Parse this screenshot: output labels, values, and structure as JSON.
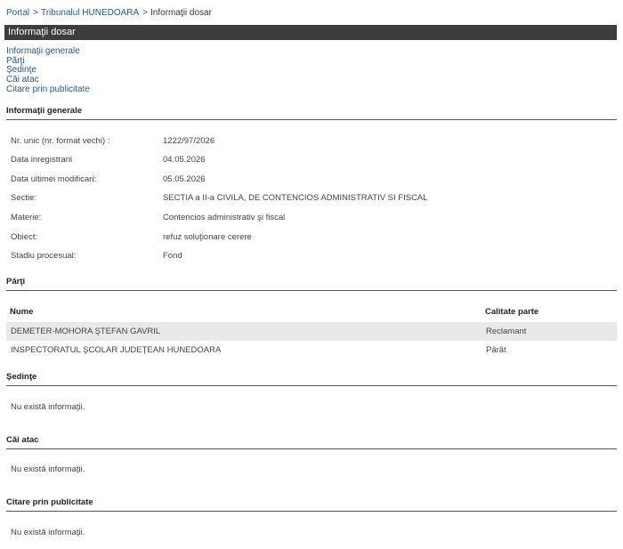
{
  "breadcrumb": {
    "portal": "Portal",
    "court": "Tribunalul HUNEDOARA",
    "current": "Informaţii dosar",
    "separator": ">"
  },
  "title": "Informaţii dosar",
  "nav": [
    "Informaţii generale",
    "Părţi",
    "Şedinţe",
    "Căi atac",
    "Citare prin publicitate"
  ],
  "general": {
    "heading": "Informaţii generale",
    "rows": [
      {
        "label": "Nr. unic (nr. format vechi) :",
        "value": "1222/97/2026"
      },
      {
        "label": "Data inregistrarii",
        "value": "04.05.2026"
      },
      {
        "label": "Data ultimei modificari:",
        "value": "05.05.2026"
      },
      {
        "label": "Sectie:",
        "value": "SECTIA a II-a CIVILA, DE CONTENCIOS ADMINISTRATIV SI FISCAL"
      },
      {
        "label": "Materie:",
        "value": "Contencios administrativ şi fiscal"
      },
      {
        "label": "Obiect:",
        "value": "refuz soluţionare cerere"
      },
      {
        "label": "Stadiu procesual:",
        "value": "Fond"
      }
    ]
  },
  "parti": {
    "heading": "Părţi",
    "col_name": "Nume",
    "col_role": "Calitate parte",
    "rows": [
      {
        "name": "DEMETER-MOHORA ŞTEFAN GAVRIL",
        "role": "Reclamant"
      },
      {
        "name": "INSPECTORATUL ŞCOLAR JUDEŢEAN HUNEDOARA",
        "role": "Pârât"
      }
    ]
  },
  "sedinte": {
    "heading": "Şedinţe",
    "empty": "Nu există informaţii."
  },
  "cai_atac": {
    "heading": "Căi atac",
    "empty": "Nu există informaţii."
  },
  "citare": {
    "heading": "Citare prin publicitate",
    "empty": "Nu există informaţii."
  }
}
